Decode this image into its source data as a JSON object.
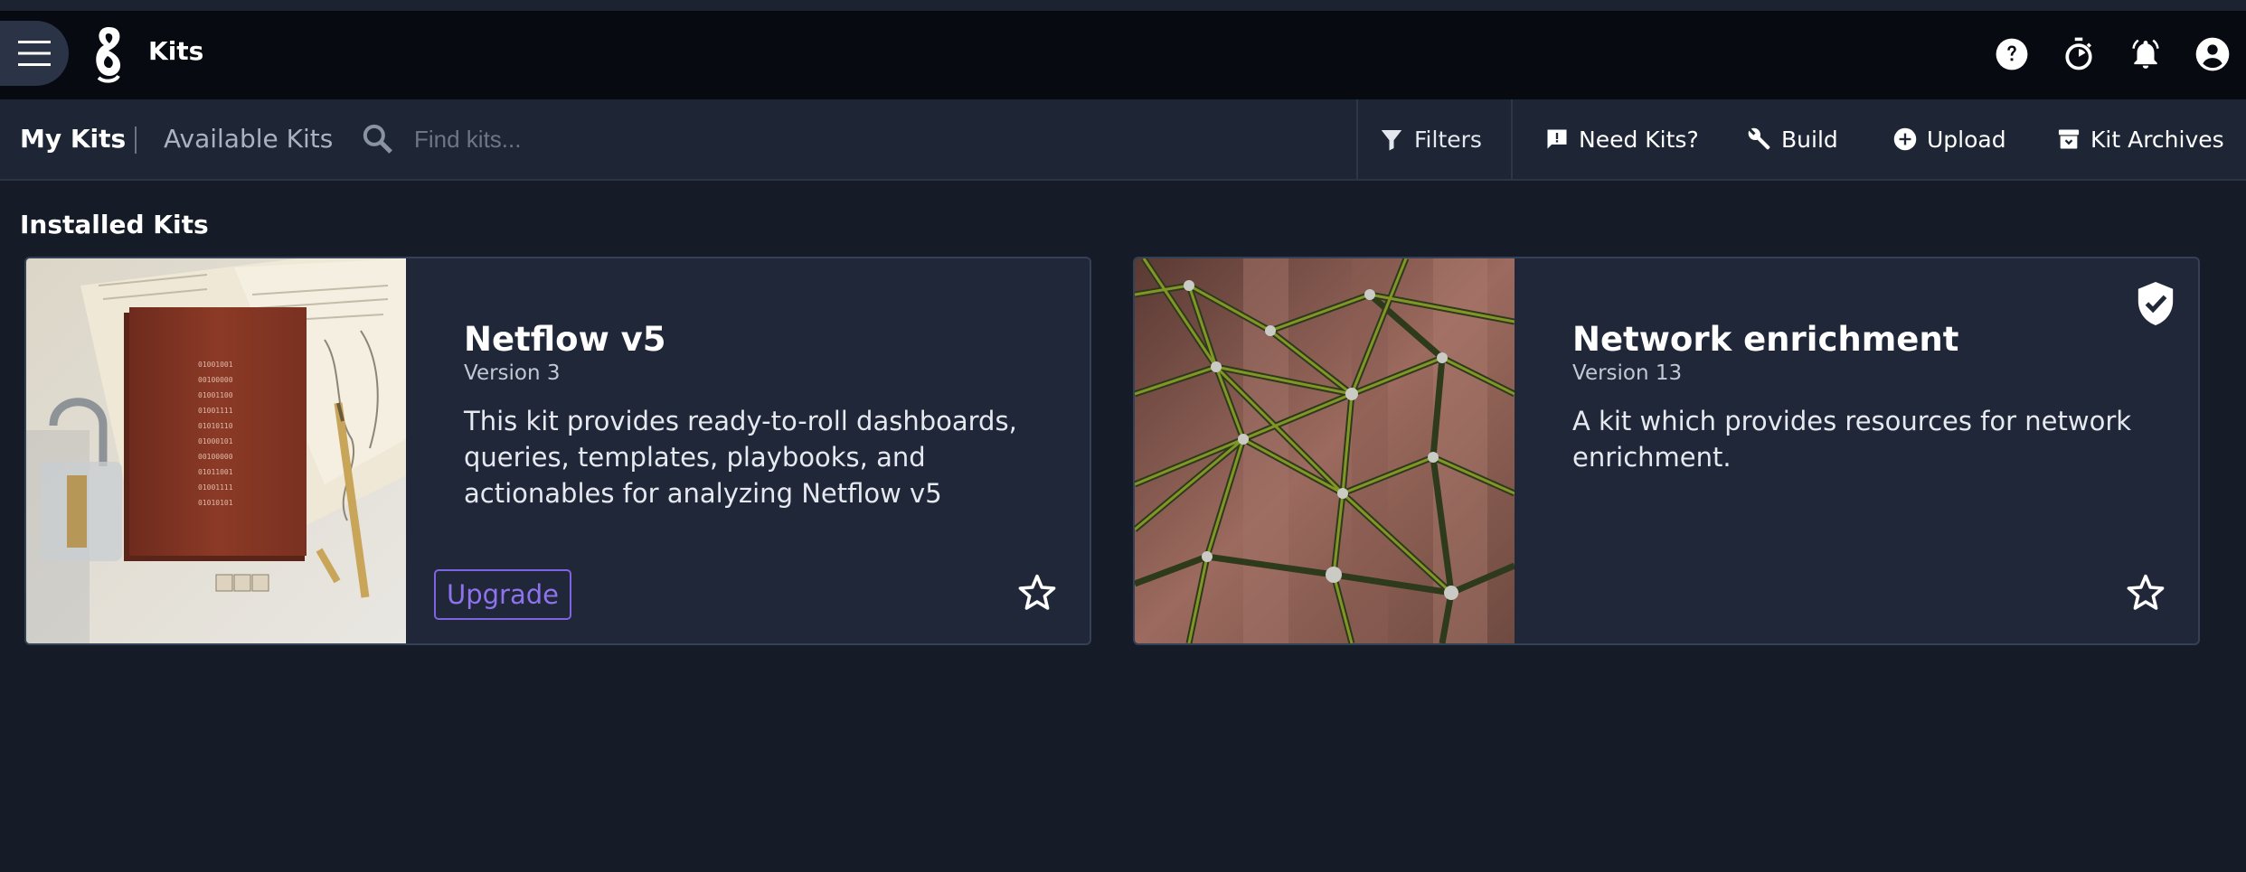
{
  "app": {
    "title": "Kits",
    "logo_icon": "gravwell-logo-icon",
    "header_icons": [
      "help-icon",
      "timer-icon",
      "notifications-bell-icon",
      "account-icon"
    ]
  },
  "toolbar": {
    "tabs": [
      {
        "label": "My Kits",
        "active": true
      },
      {
        "label": "Available Kits",
        "active": false
      }
    ],
    "search": {
      "placeholder": "Find kits...",
      "value": ""
    },
    "filters_label": "Filters",
    "actions": [
      {
        "label": "Need Kits?",
        "icon": "feedback-icon"
      },
      {
        "label": "Build",
        "icon": "wrench-icon"
      },
      {
        "label": "Upload",
        "icon": "add-circle-icon"
      },
      {
        "label": "Kit Archives",
        "icon": "archive-icon"
      }
    ]
  },
  "main": {
    "section_title": "Installed Kits",
    "kits": [
      {
        "name": "Netflow v5",
        "version": "Version 3",
        "description": "This kit provides ready-to-roll dashboards, queries, templates, playbooks, and actionables for analyzing Netflow v5",
        "upgrade_label": "Upgrade",
        "image": "red-notebook-padlock-image",
        "favorite": false
      },
      {
        "name": "Network enrichment",
        "version": "Version 13",
        "description": "A kit which provides resources for network enrichment.",
        "verified": true,
        "image": "rope-network-image",
        "favorite": false
      }
    ]
  },
  "colors": {
    "background": "#151b27",
    "appbar": "#070a10",
    "toolbar": "#1e2636",
    "card": "#1f2738",
    "accent": "#7f63e0"
  }
}
